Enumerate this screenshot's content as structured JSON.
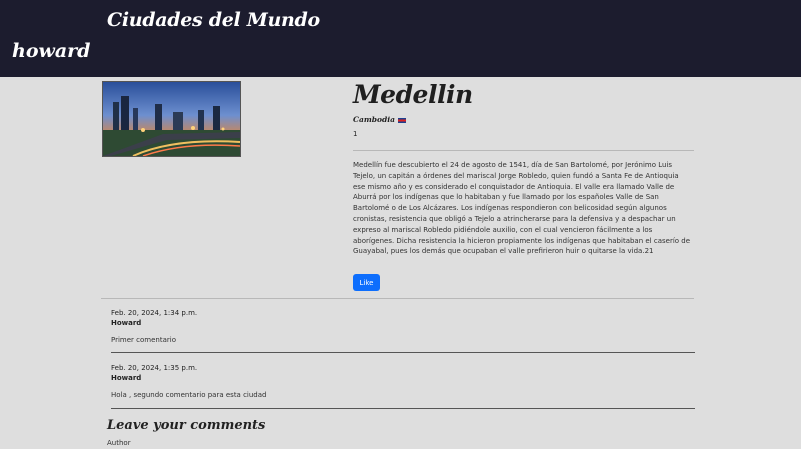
{
  "header": {
    "brand": "Ciudades del Mundo",
    "username": "howard"
  },
  "city": {
    "name": "Medellin",
    "country": "Cambodia",
    "likes": "1",
    "description": "Medellín fue descubierto el 24 de agosto de 1541, día de San Bartolomé, por Jerónimo Luis Tejelo, un capitán a órdenes del mariscal Jorge Robledo, quien fundó a Santa Fe de Antioquia ese mismo año y es considerado el conquistador de Antioquia. El valle era llamado Valle de Aburrá por los indígenas que lo habitaban y fue llamado por los españoles Valle de San Bartolomé o de Los Alcázares. Los indígenas respondieron con belicosidad según algunos cronistas, resistencia que obligó a Tejelo a atrincherarse para la defensiva y a despachar un expreso al mariscal Robledo pidiéndole auxilio, con el cual vencieron fácilmente a los aborígenes. Dicha resistencia la hicieron propiamente los indígenas que habitaban el caserío de Guayabal, pues los demás que ocupaban el valle prefirieron huir o quitarse la vida.21",
    "like_label": "Like",
    "like_button_color": "#0d6efd"
  },
  "comments": [
    {
      "date": "Feb. 20, 2024, 1:34 p.m.",
      "author": "Howard",
      "text": "Primer comentario"
    },
    {
      "date": "Feb. 20, 2024, 1:35 p.m.",
      "author": "Howard",
      "text": "Hola , segundo comentario para esta ciudad"
    }
  ],
  "form": {
    "heading": "Leave your comments",
    "author_label": "Author"
  },
  "colors": {
    "header_bg": "#1c1c2e",
    "page_bg": "#dedede"
  }
}
